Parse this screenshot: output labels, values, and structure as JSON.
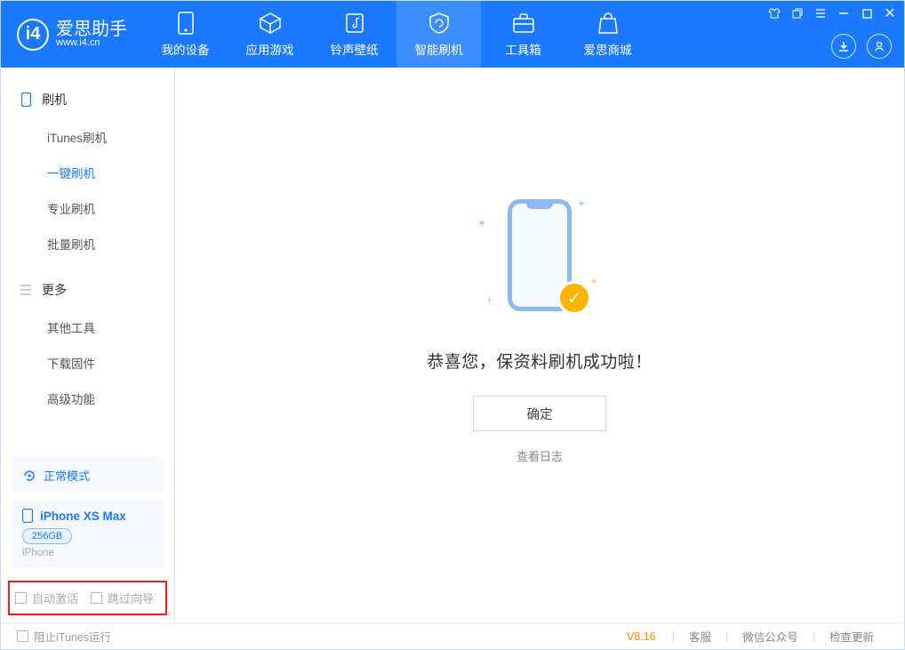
{
  "app": {
    "name_cn": "爱思助手",
    "name_en": "www.i4.cn"
  },
  "nav": {
    "my_device": "我的设备",
    "apps_games": "应用游戏",
    "ringtones": "铃声壁纸",
    "flash": "智能刷机",
    "toolbox": "工具箱",
    "store": "爱思商城"
  },
  "sidebar": {
    "group_flash": "刷机",
    "itunes_flash": "iTunes刷机",
    "oneclick_flash": "一键刷机",
    "pro_flash": "专业刷机",
    "batch_flash": "批量刷机",
    "group_more": "更多",
    "other_tools": "其他工具",
    "download_fw": "下载固件",
    "adv_func": "高级功能"
  },
  "device": {
    "mode_label": "正常模式",
    "name": "iPhone XS Max",
    "capacity": "256GB",
    "type": "iPhone"
  },
  "options": {
    "auto_activate": "自动激活",
    "skip_guide": "跳过向导"
  },
  "main": {
    "success_msg": "恭喜您，保资料刷机成功啦！",
    "confirm": "确定",
    "view_log": "查看日志"
  },
  "footer": {
    "block_itunes": "阻止iTunes运行",
    "version": "V8.16",
    "support": "客服",
    "wechat": "微信公众号",
    "check_update": "检查更新"
  }
}
